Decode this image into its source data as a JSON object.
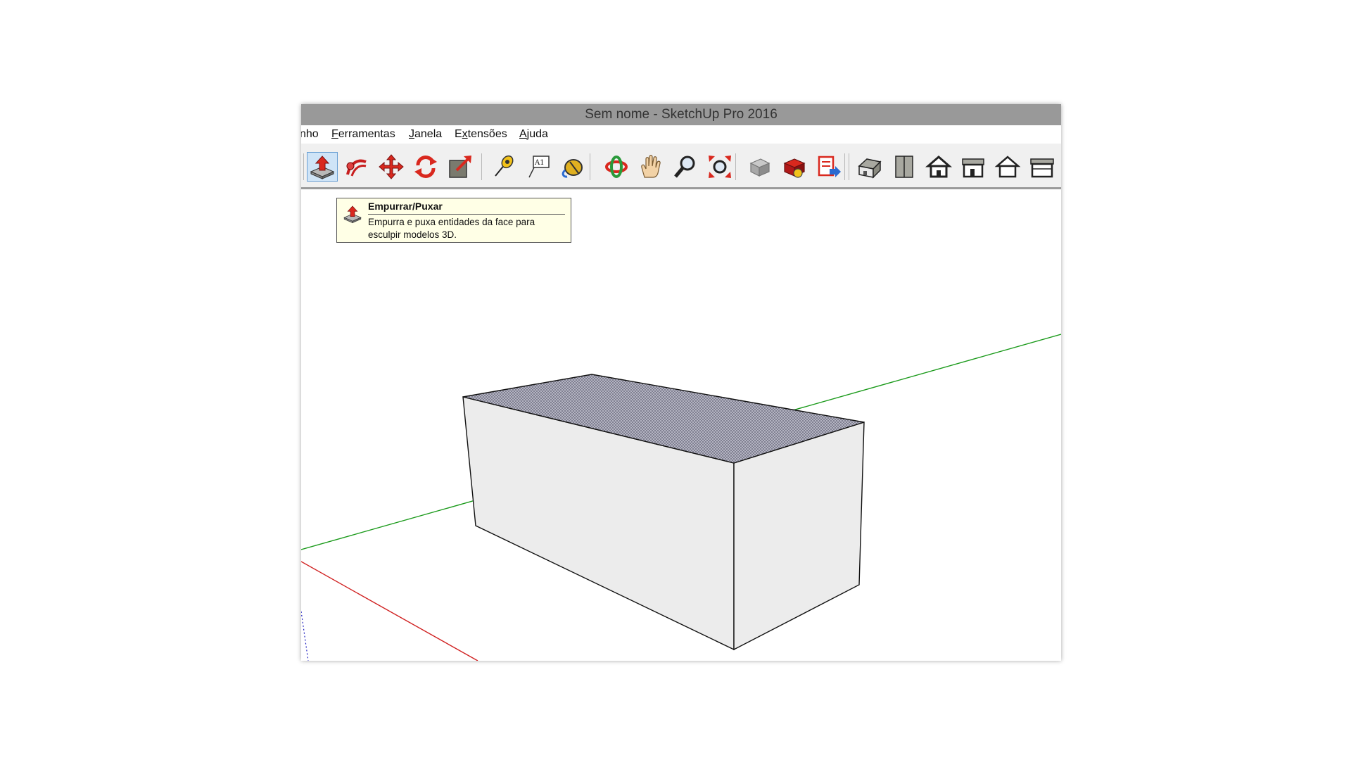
{
  "window": {
    "title": "Sem nome - SketchUp Pro 2016"
  },
  "menubar": {
    "items": [
      {
        "label": "nho"
      },
      {
        "label": "Ferramentas"
      },
      {
        "label": "Janela"
      },
      {
        "label": "Extensões"
      },
      {
        "label": "Ajuda"
      }
    ]
  },
  "toolbar": {
    "buttons": [
      {
        "icon": "push-pull-icon",
        "active": true
      },
      {
        "icon": "follow-me-icon"
      },
      {
        "icon": "move-icon"
      },
      {
        "icon": "rotate-icon"
      },
      {
        "icon": "scale-icon"
      },
      {
        "icon": "tape-measure-icon"
      },
      {
        "icon": "text-icon",
        "text": "A1"
      },
      {
        "icon": "paint-bucket-icon"
      },
      {
        "icon": "orbit-icon"
      },
      {
        "icon": "pan-icon"
      },
      {
        "icon": "zoom-icon"
      },
      {
        "icon": "zoom-extents-icon"
      },
      {
        "icon": "3d-warehouse-icon"
      },
      {
        "icon": "extension-warehouse-icon"
      },
      {
        "icon": "send-to-layout-icon"
      },
      {
        "icon": "iso-view-icon"
      },
      {
        "icon": "top-view-icon"
      },
      {
        "icon": "front-view-icon"
      },
      {
        "icon": "right-view-icon"
      },
      {
        "icon": "back-view-icon"
      },
      {
        "icon": "left-view-icon"
      }
    ]
  },
  "tooltip": {
    "icon": "push-pull-icon",
    "title": "Empurrar/Puxar",
    "description": "Empurra e puxa entidades da face para esculpir modelos 3D."
  },
  "scene": {
    "colors": {
      "x_axis": "#d02020",
      "y_axis": "#1a9a1a",
      "z_axis": "#2020c0",
      "face_front": "#ececec",
      "face_top": "#9a9aaa",
      "edge": "#111111"
    }
  }
}
